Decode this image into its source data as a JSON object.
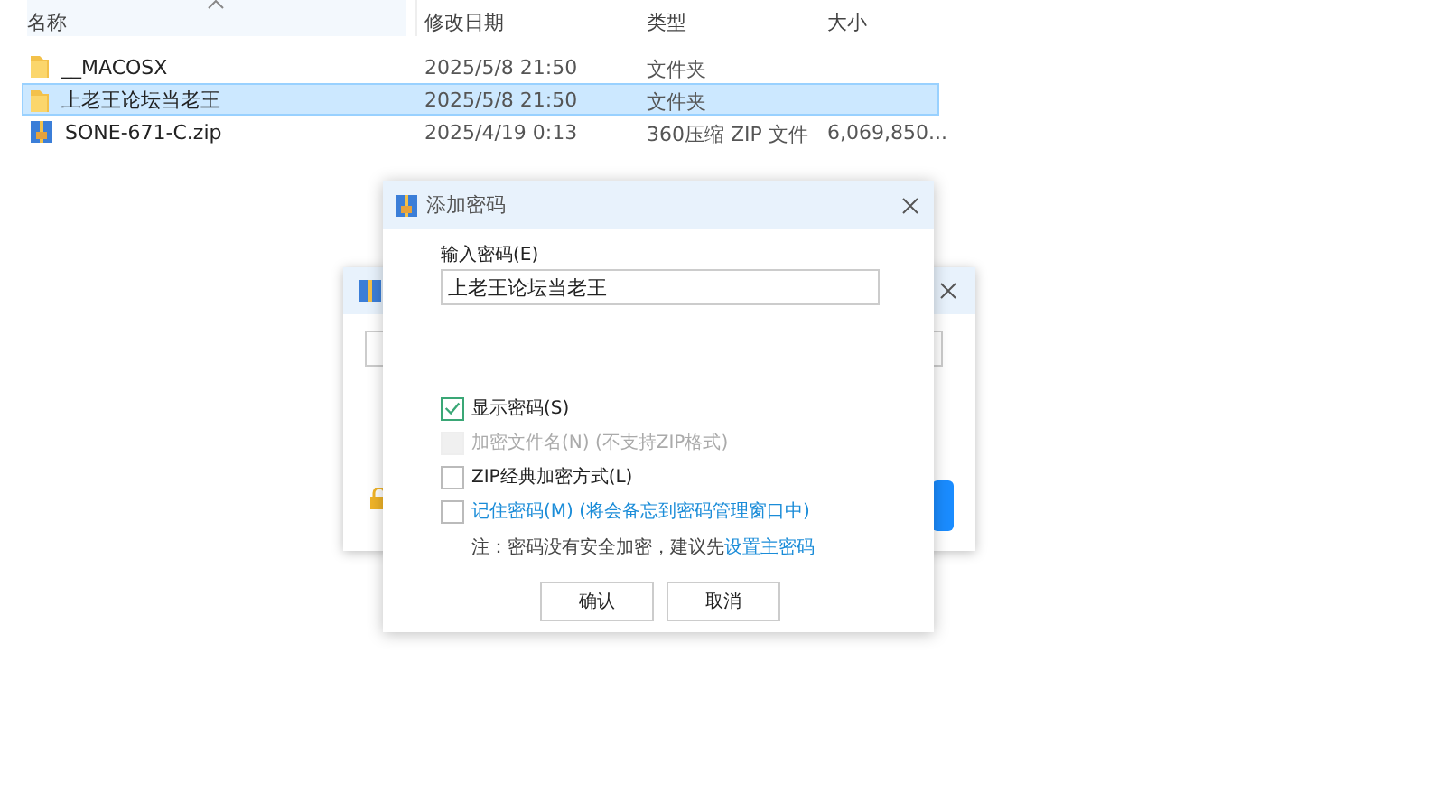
{
  "file_list": {
    "columns": [
      {
        "label": "名称",
        "sorted": true
      },
      {
        "label": "修改日期",
        "sorted": false
      },
      {
        "label": "类型",
        "sorted": false
      },
      {
        "label": "大小",
        "sorted": false
      }
    ],
    "rows": [
      {
        "kind": "folder",
        "name": "__MACOSX",
        "date": "2025/5/8 21:50",
        "type": "文件夹",
        "size": null,
        "selected": false
      },
      {
        "kind": "folder",
        "name": "上老王论坛当老王",
        "date": "2025/5/8 21:50",
        "type": "文件夹",
        "size": null,
        "selected": true
      },
      {
        "kind": "archive",
        "name": "SONE-671-C.zip",
        "date": "2025/4/19 0:13",
        "type": "360压缩 ZIP 文件",
        "size": "6,069,850...",
        "selected": false
      }
    ]
  },
  "password_dialog": {
    "title": "添加密码",
    "password_label": "输入密码(E)",
    "password_value": "上老王论坛当老王",
    "options": [
      {
        "label": "显示密码(S)",
        "checked": true,
        "disabled": false,
        "link": false
      },
      {
        "label": "加密文件名(N) (不支持ZIP格式)",
        "checked": false,
        "disabled": true,
        "link": false
      },
      {
        "label": "ZIP经典加密方式(L)",
        "checked": false,
        "disabled": false,
        "link": false
      },
      {
        "label": "记住密码(M) (将会备忘到密码管理窗口中)",
        "checked": false,
        "disabled": false,
        "link": true
      }
    ],
    "note": "注：密码没有安全加密，建议先",
    "note_link": "设置主密码",
    "buttons": [
      "确认",
      "取消"
    ]
  }
}
